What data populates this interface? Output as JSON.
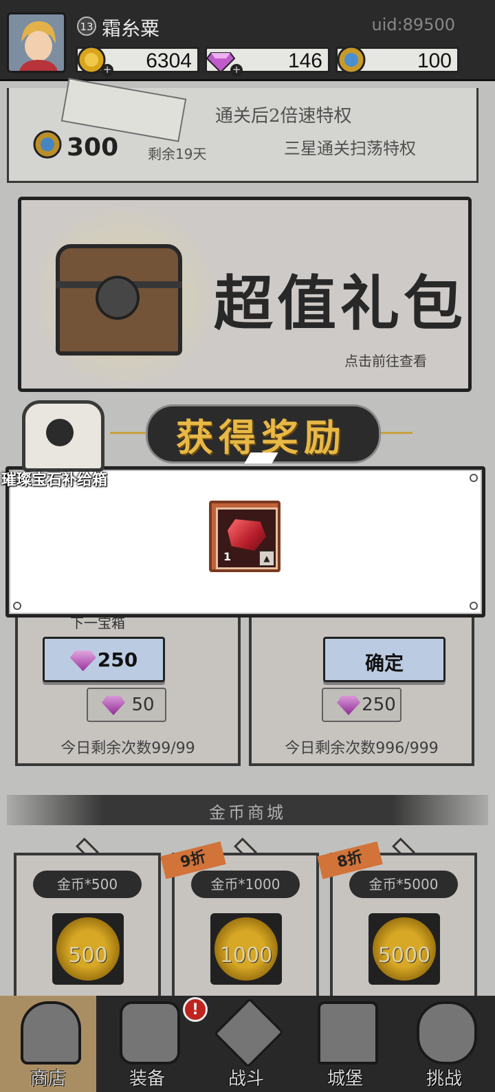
{
  "player": {
    "level": "13",
    "name": "霜糸粟",
    "uid": "uid:89500"
  },
  "resources": {
    "gold": "6304",
    "gems": "146",
    "tokens": "100"
  },
  "vip": {
    "line1": "通关后2倍速特权",
    "line2": "三星通关扫荡特权",
    "price": "300",
    "remaining": "剩余19天"
  },
  "pack": {
    "title": "超值礼包",
    "subtitle": "点击前往查看"
  },
  "reward_popup": {
    "title": "获得奖励",
    "chest_name": "璀璨宝石补给箱",
    "item": {
      "count": "1",
      "icon": "red-gem"
    }
  },
  "shop": {
    "next_chest_label": "下一宝箱",
    "left": {
      "price": "250",
      "sub_price": "50",
      "daily": "今日剩余次数99/99"
    },
    "right": {
      "button": "确定",
      "sub_price": "250",
      "daily": "今日剩余次数996/999"
    }
  },
  "gold_shop": {
    "header": "金币商城",
    "items": [
      {
        "name": "金币*500",
        "amount": "500",
        "discount": ""
      },
      {
        "name": "金币*1000",
        "amount": "1000",
        "discount": "9折"
      },
      {
        "name": "金币*5000",
        "amount": "5000",
        "discount": "8折"
      }
    ]
  },
  "nav": {
    "items": [
      {
        "label": "商店",
        "active": true
      },
      {
        "label": "装备",
        "badge": "!"
      },
      {
        "label": "战斗"
      },
      {
        "label": "城堡"
      },
      {
        "label": "挑战"
      }
    ]
  },
  "colors": {
    "accent_gold": "#e8b846",
    "active_tab": "#b7986a",
    "button_blue": "#c9dcf3",
    "item_frame": "#c0623a"
  }
}
